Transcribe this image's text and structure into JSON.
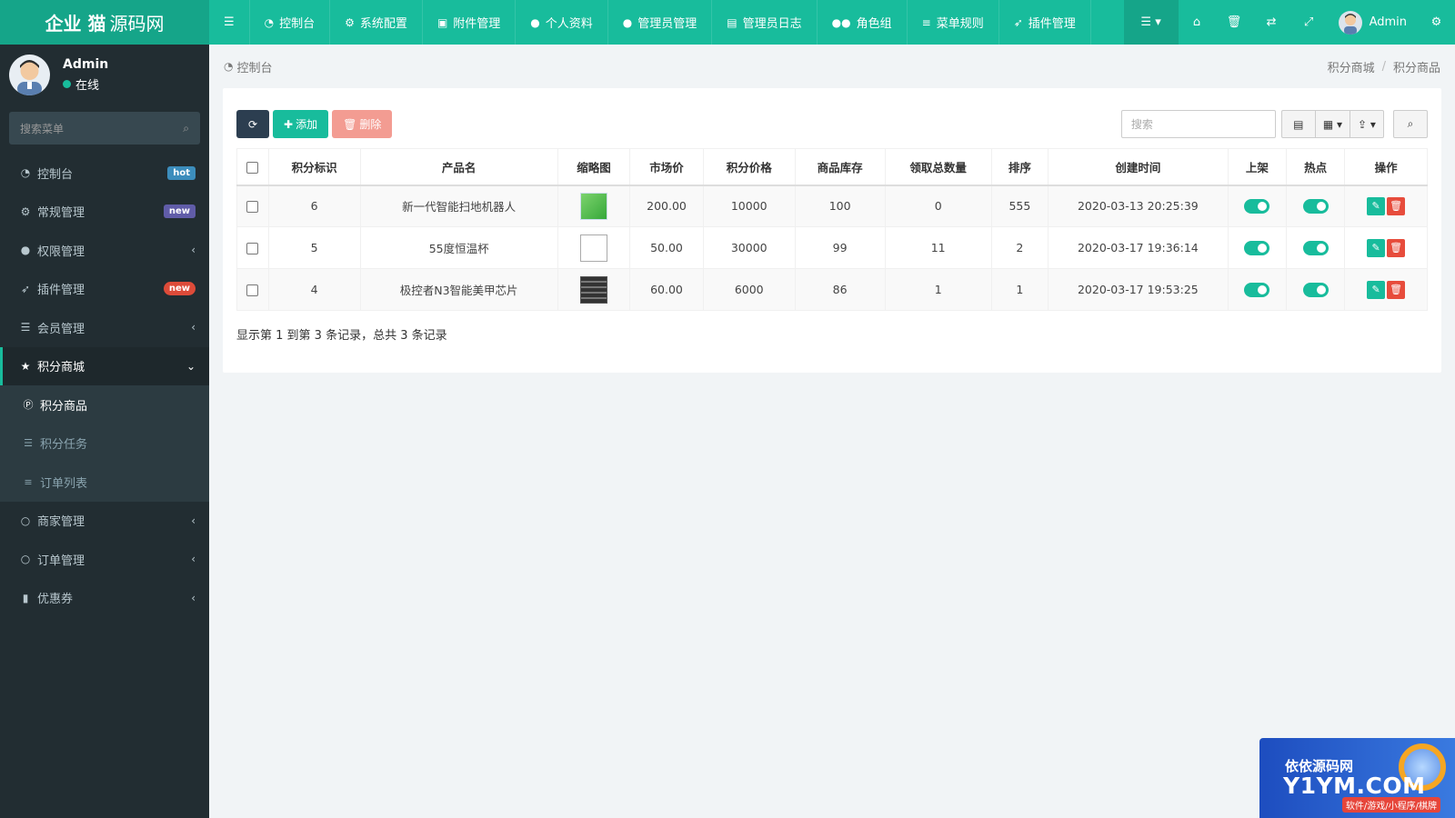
{
  "brand": {
    "bold": "企业 猫",
    "rest": "源码网"
  },
  "topnav": [
    {
      "icon": "dashboard-icon",
      "glyph": "◔",
      "label": "控制台"
    },
    {
      "icon": "gear-icon",
      "glyph": "⚙",
      "label": "系统配置"
    },
    {
      "icon": "file-image-icon",
      "glyph": "▣",
      "label": "附件管理"
    },
    {
      "icon": "user-icon",
      "glyph": "👤",
      "label": "个人资料"
    },
    {
      "icon": "user-icon",
      "glyph": "👤",
      "label": "管理员管理"
    },
    {
      "icon": "list-alt-icon",
      "glyph": "▤",
      "label": "管理员日志"
    },
    {
      "icon": "group-icon",
      "glyph": "👥",
      "label": "角色组"
    },
    {
      "icon": "bars-icon",
      "glyph": "≡",
      "label": "菜单规则"
    },
    {
      "icon": "rocket-icon",
      "glyph": "➶",
      "label": "插件管理"
    }
  ],
  "topright": {
    "user": "Admin"
  },
  "user": {
    "name": "Admin",
    "status": "在线"
  },
  "sidebar": {
    "search_placeholder": "搜索菜单",
    "items": [
      {
        "label": "控制台",
        "badge": "hot",
        "badge_color": "#3c8dbc"
      },
      {
        "label": "常规管理",
        "badge": "new",
        "badge_color": "#605ca8"
      },
      {
        "label": "权限管理",
        "chevron": "‹"
      },
      {
        "label": "插件管理",
        "badge": "new",
        "badge_color": "#dd4b39"
      },
      {
        "label": "会员管理",
        "chevron": "‹"
      },
      {
        "label": "积分商城",
        "chevron": "⌄"
      },
      {
        "label": "商家管理",
        "chevron": "‹"
      },
      {
        "label": "订单管理",
        "chevron": "‹"
      },
      {
        "label": "优惠券",
        "chevron": "‹"
      }
    ],
    "sub": [
      {
        "label": "积分商品"
      },
      {
        "label": "积分任务"
      },
      {
        "label": "订单列表"
      }
    ]
  },
  "breadcrumb": {
    "left": "控制台",
    "right": [
      "积分商城",
      "积分商品"
    ]
  },
  "toolbar": {
    "add_label": "添加",
    "delete_label": "删除",
    "search_placeholder": "搜索"
  },
  "table": {
    "headers": [
      "积分标识",
      "产品名",
      "缩略图",
      "市场价",
      "积分价格",
      "商品库存",
      "领取总数量",
      "排序",
      "创建时间",
      "上架",
      "热点",
      "操作"
    ],
    "rows": [
      {
        "id": "6",
        "name": "新一代智能扫地机器人",
        "price": "200.00",
        "points": "10000",
        "stock": "100",
        "claimed": "0",
        "sort": "555",
        "created": "2020-03-13 20:25:39"
      },
      {
        "id": "5",
        "name": "55度恒温杯",
        "price": "50.00",
        "points": "30000",
        "stock": "99",
        "claimed": "11",
        "sort": "2",
        "created": "2020-03-17 19:36:14"
      },
      {
        "id": "4",
        "name": "极控者N3智能美甲芯片",
        "price": "60.00",
        "points": "6000",
        "stock": "86",
        "claimed": "1",
        "sort": "1",
        "created": "2020-03-17 19:53:25"
      }
    ],
    "summary": "显示第 1 到第 3 条记录，总共 3 条记录"
  },
  "watermark": {
    "line1": "依依源码网",
    "line2": "Y1YM.COM",
    "line3": "软件/游戏/小程序/棋牌"
  }
}
